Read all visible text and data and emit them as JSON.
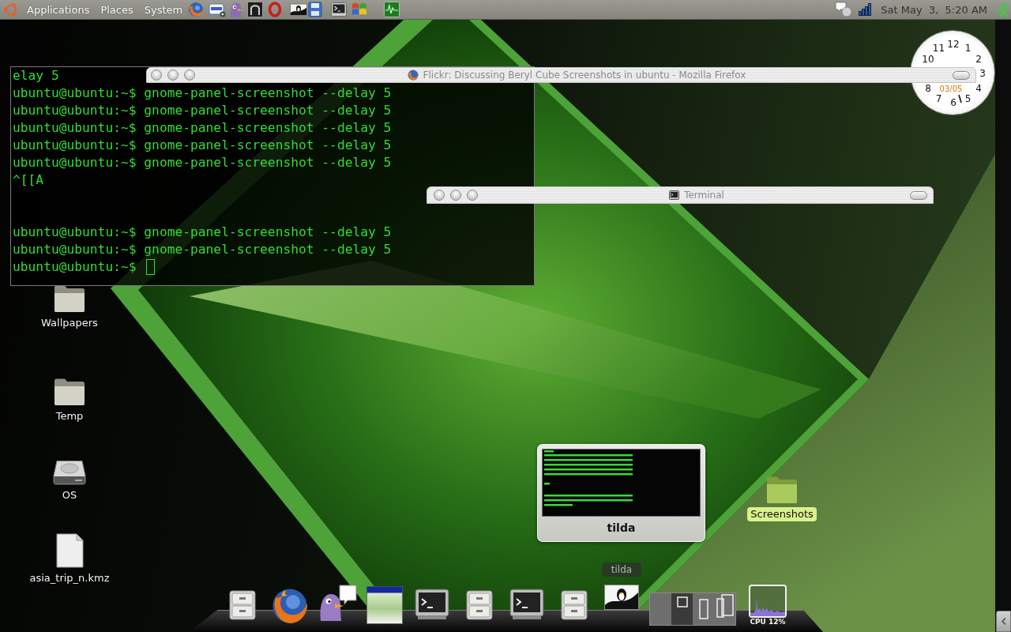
{
  "top_panel": {
    "menus": [
      "Applications",
      "Places",
      "System"
    ],
    "clock": "Sat May  3,  5:20 AM"
  },
  "desktop_icons": [
    {
      "label": "Wallpapers",
      "kind": "folder",
      "selected": false
    },
    {
      "label": "Temp",
      "kind": "folder",
      "selected": false
    },
    {
      "label": "OS",
      "kind": "drive",
      "selected": false
    },
    {
      "label": "asia_trip_n.kmz",
      "kind": "file",
      "selected": false
    },
    {
      "label": "Screenshots",
      "kind": "folder",
      "selected": true
    }
  ],
  "tilda": {
    "output_blocks": [
      [
        "elay 5",
        "ubuntu@ubuntu:~$ gnome-panel-screenshot --delay 5",
        "ubuntu@ubuntu:~$ gnome-panel-screenshot --delay 5",
        "ubuntu@ubuntu:~$ gnome-panel-screenshot --delay 5",
        "ubuntu@ubuntu:~$ gnome-panel-screenshot --delay 5",
        "ubuntu@ubuntu:~$ gnome-panel-screenshot --delay 5",
        "^[[A"
      ],
      [
        "ubuntu@ubuntu:~$ gnome-panel-screenshot --delay 5",
        "ubuntu@ubuntu:~$ gnome-panel-screenshot --delay 5",
        "ubuntu@ubuntu:~$"
      ]
    ]
  },
  "clock_widget": {
    "numbers": [
      "12",
      "1",
      "2",
      "3",
      "4",
      "5",
      "6",
      "7",
      "8",
      "10",
      "11"
    ],
    "date": "03/05"
  },
  "windows": [
    {
      "kind": "browser",
      "title": "Flickr: Discussing Beryl Cube Screenshots in ubuntu - Mozilla Firefox"
    },
    {
      "kind": "terminal",
      "title": "Terminal"
    }
  ],
  "window_preview": {
    "title": "tilda"
  },
  "dock": {
    "tooltip": "tilda",
    "workspaces": [
      {
        "selected": false
      },
      {
        "selected": true
      },
      {
        "selected": false
      },
      {
        "selected": false
      }
    ],
    "cpu_label": "CPU 12%"
  }
}
